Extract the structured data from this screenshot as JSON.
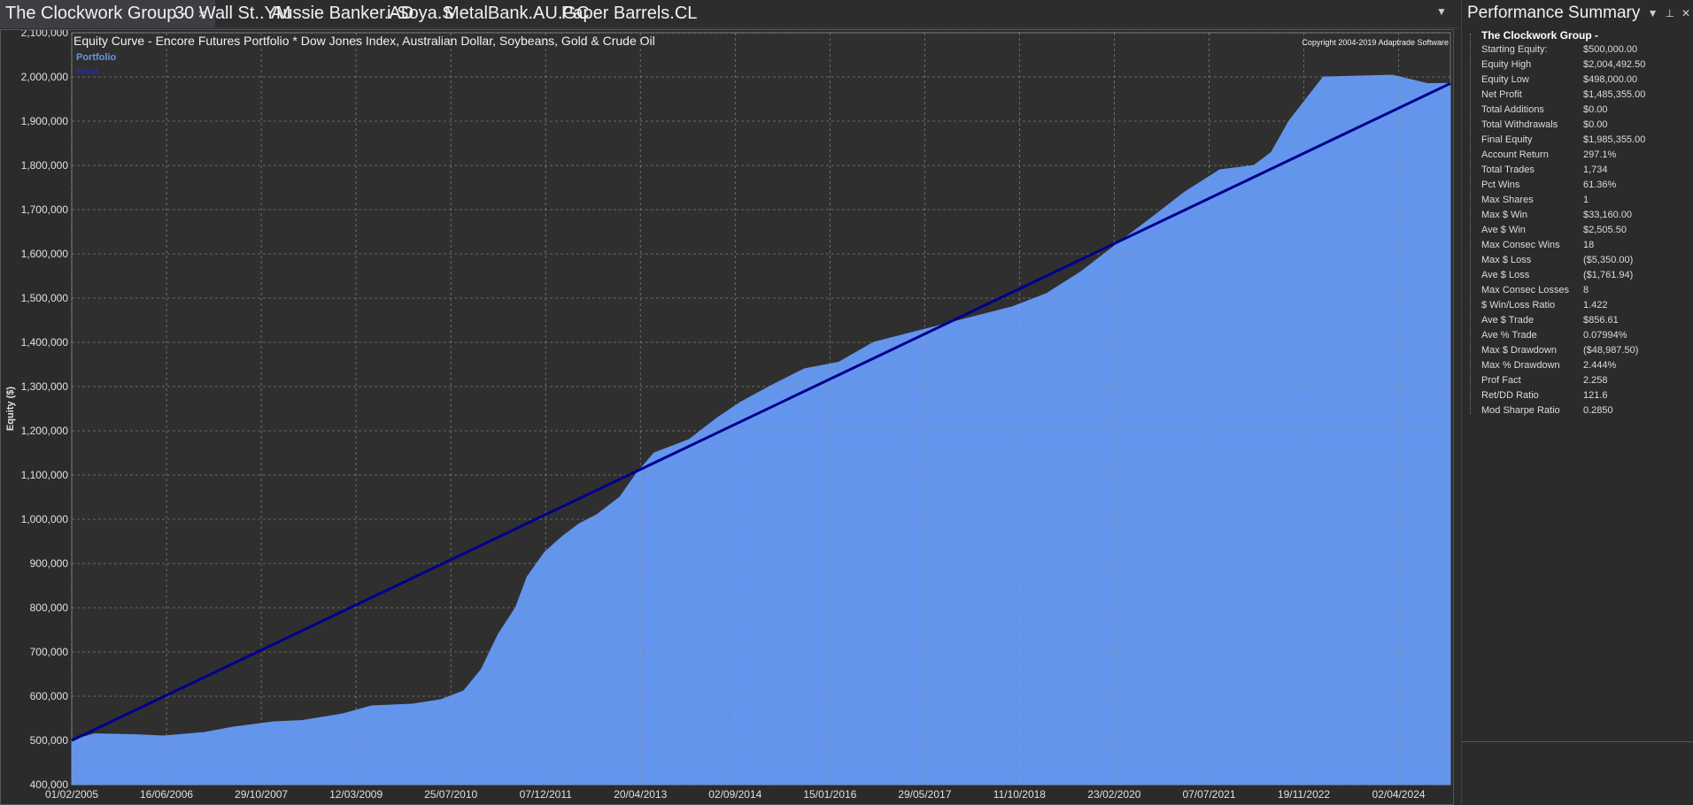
{
  "tabs": [
    {
      "label": "The Clockwork Group -",
      "active": true,
      "close": "×"
    },
    {
      "label": "30 Wall St..YM"
    },
    {
      "label": "Aussie Banker.AD"
    },
    {
      "label": "i-Soya.S"
    },
    {
      "label": "MetalBank.AU.GC"
    },
    {
      "label": "Paper Barrels.CL"
    }
  ],
  "tab_dropdown_icon": "chevron-down-icon",
  "performance": {
    "title": "Performance Summary",
    "group_name": "The Clockwork Group -",
    "rows": [
      {
        "label": "Starting Equity:",
        "value": "$500,000.00"
      },
      {
        "label": "Equity High",
        "value": "$2,004,492.50"
      },
      {
        "label": "Equity Low",
        "value": "$498,000.00"
      },
      {
        "label": "Net Profit",
        "value": "$1,485,355.00"
      },
      {
        "label": "Total Additions",
        "value": "$0.00"
      },
      {
        "label": "Total Withdrawals",
        "value": "$0.00"
      },
      {
        "label": "Final Equity",
        "value": "$1,985,355.00"
      },
      {
        "label": "Account Return",
        "value": "297.1%"
      },
      {
        "label": "Total Trades",
        "value": "1,734"
      },
      {
        "label": "Pct Wins",
        "value": "61.36%"
      },
      {
        "label": "Max Shares",
        "value": "1"
      },
      {
        "label": "Max $ Win",
        "value": "$33,160.00"
      },
      {
        "label": "Ave $ Win",
        "value": "$2,505.50"
      },
      {
        "label": "Max Consec Wins",
        "value": "18"
      },
      {
        "label": "Max $ Loss",
        "value": "($5,350.00)"
      },
      {
        "label": "Ave $ Loss",
        "value": "($1,761.94)"
      },
      {
        "label": "Max Consec Losses",
        "value": "8"
      },
      {
        "label": "$ Win/Loss Ratio",
        "value": "1.422"
      },
      {
        "label": "Ave $ Trade",
        "value": "$856.61"
      },
      {
        "label": "Ave % Trade",
        "value": "0.07994%"
      },
      {
        "label": "Max $ Drawdown",
        "value": "($48,987.50)"
      },
      {
        "label": "Max % Drawdown",
        "value": "2.444%"
      },
      {
        "label": "Prof Fact",
        "value": "2.258"
      },
      {
        "label": "Ret/DD Ratio",
        "value": "121.6"
      },
      {
        "label": "Mod Sharpe Ratio",
        "value": "0.2850"
      }
    ]
  },
  "chart_data": {
    "type": "area",
    "title": "Equity Curve - Encore Futures Portfolio * Dow Jones Index, Australian Dollar, Soybeans, Gold & Crude Oil",
    "copyright": "Copyright 2004-2019 Adaptrade Software",
    "ylabel": "Equity ($)",
    "xlabel": "",
    "ylim": [
      400000,
      2100000
    ],
    "xlim": [
      "01/02/2005",
      "31/12/2024"
    ],
    "grid": true,
    "legend_placement": "top-left",
    "y_ticks": [
      "400,000",
      "500,000",
      "600,000",
      "700,000",
      "800,000",
      "900,000",
      "1,000,000",
      "1,100,000",
      "1,200,000",
      "1,300,000",
      "1,400,000",
      "1,500,000",
      "1,600,000",
      "1,700,000",
      "1,800,000",
      "1,900,000",
      "2,000,000",
      "2,100,000"
    ],
    "y_tick_values": [
      400000,
      500000,
      600000,
      700000,
      800000,
      900000,
      1000000,
      1100000,
      1200000,
      1300000,
      1400000,
      1500000,
      1600000,
      1700000,
      1800000,
      1900000,
      2000000,
      2100000
    ],
    "x_ticks": [
      "01/02/2005",
      "16/06/2006",
      "29/10/2007",
      "12/03/2009",
      "25/07/2010",
      "07/12/2011",
      "20/04/2013",
      "02/09/2014",
      "15/01/2016",
      "29/05/2017",
      "11/10/2018",
      "23/02/2020",
      "07/07/2021",
      "19/11/2022",
      "02/04/2024"
    ],
    "series": [
      {
        "name": "Portfolio",
        "color": "#6495ed",
        "kind": "area",
        "x": [
          "01/02/2005",
          "01/06/2005",
          "01/01/2006",
          "01/06/2006",
          "01/01/2007",
          "01/06/2007",
          "01/01/2008",
          "01/06/2008",
          "01/01/2009",
          "01/06/2009",
          "01/01/2010",
          "01/06/2010",
          "01/10/2010",
          "01/01/2011",
          "01/04/2011",
          "01/07/2011",
          "01/09/2011",
          "01/12/2011",
          "01/03/2012",
          "01/06/2012",
          "01/09/2012",
          "01/01/2013",
          "01/04/2013",
          "01/07/2013",
          "01/01/2014",
          "01/06/2014",
          "01/10/2014",
          "01/03/2015",
          "01/09/2015",
          "01/03/2016",
          "01/09/2016",
          "01/03/2017",
          "01/09/2017",
          "01/03/2018",
          "01/09/2018",
          "01/03/2019",
          "01/09/2019",
          "01/03/2020",
          "01/09/2020",
          "01/03/2021",
          "01/09/2021",
          "01/03/2022",
          "01/06/2022",
          "01/09/2022",
          "01/03/2023",
          "01/09/2023",
          "01/03/2024",
          "01/09/2024",
          "31/12/2024"
        ],
        "values": [
          500000,
          515000,
          513000,
          510000,
          518000,
          530000,
          542000,
          545000,
          560000,
          578000,
          582000,
          592000,
          612000,
          660000,
          740000,
          800000,
          870000,
          925000,
          960000,
          990000,
          1010000,
          1050000,
          1105000,
          1150000,
          1180000,
          1230000,
          1265000,
          1300000,
          1340000,
          1355000,
          1400000,
          1420000,
          1440000,
          1460000,
          1480000,
          1510000,
          1560000,
          1620000,
          1680000,
          1740000,
          1790000,
          1800000,
          1830000,
          1900000,
          2000000,
          2002000,
          2004000,
          1985000,
          1985355
        ]
      },
      {
        "name": "Ideal",
        "color": "#00008b",
        "kind": "line",
        "x": [
          "01/02/2005",
          "31/12/2024"
        ],
        "values": [
          500000,
          1985355
        ]
      }
    ]
  }
}
